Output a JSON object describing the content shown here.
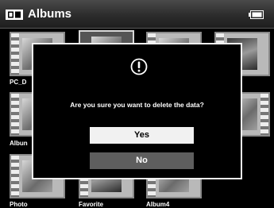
{
  "header": {
    "title": "Albums",
    "album_icon": "album-icon",
    "battery_icon": "battery-icon"
  },
  "albums": [
    {
      "label": "PC_D"
    },
    {
      "label": "Albun"
    },
    {
      "label": "Photo"
    },
    {
      "label": "Favorite"
    },
    {
      "label": "Album4"
    }
  ],
  "dialog": {
    "icon": "exclamation-icon",
    "message": "Are you sure you want to delete the data?",
    "yes_label": "Yes",
    "no_label": "No",
    "selected_option": "Yes"
  },
  "colors": {
    "background": "#000000",
    "dialog_border": "#f0f0f0",
    "yes_button": "#f1f1f1",
    "no_button": "#5e5e5e"
  }
}
